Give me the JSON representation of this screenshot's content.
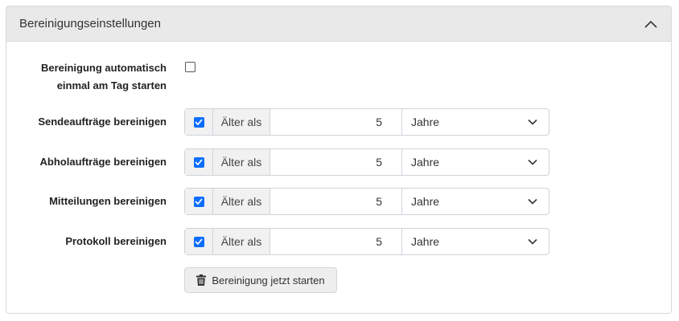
{
  "panel": {
    "title": "Bereinigungseinstellungen"
  },
  "auto_cleanup": {
    "label_line1": "Bereinigung automatisch",
    "label_line2": "einmal am Tag starten",
    "checked": false
  },
  "rows": [
    {
      "label": "Sendeaufträge bereinigen",
      "enabled": true,
      "prefix": "Älter als",
      "value": "5",
      "unit": "Jahre"
    },
    {
      "label": "Abholaufträge bereinigen",
      "enabled": true,
      "prefix": "Älter als",
      "value": "5",
      "unit": "Jahre"
    },
    {
      "label": "Mitteilungen bereinigen",
      "enabled": true,
      "prefix": "Älter als",
      "value": "5",
      "unit": "Jahre"
    },
    {
      "label": "Protokoll bereinigen",
      "enabled": true,
      "prefix": "Älter als",
      "value": "5",
      "unit": "Jahre"
    }
  ],
  "actions": {
    "start_label": "Bereinigung jetzt starten"
  },
  "icons": {
    "collapse": "chevron-up-icon",
    "select": "chevron-down-icon",
    "button": "trash-icon",
    "check": "checkmark-icon"
  },
  "colors": {
    "accent": "#0d6efd",
    "header_bg": "#e9e9e9",
    "addon_bg": "#f1f1f1"
  }
}
